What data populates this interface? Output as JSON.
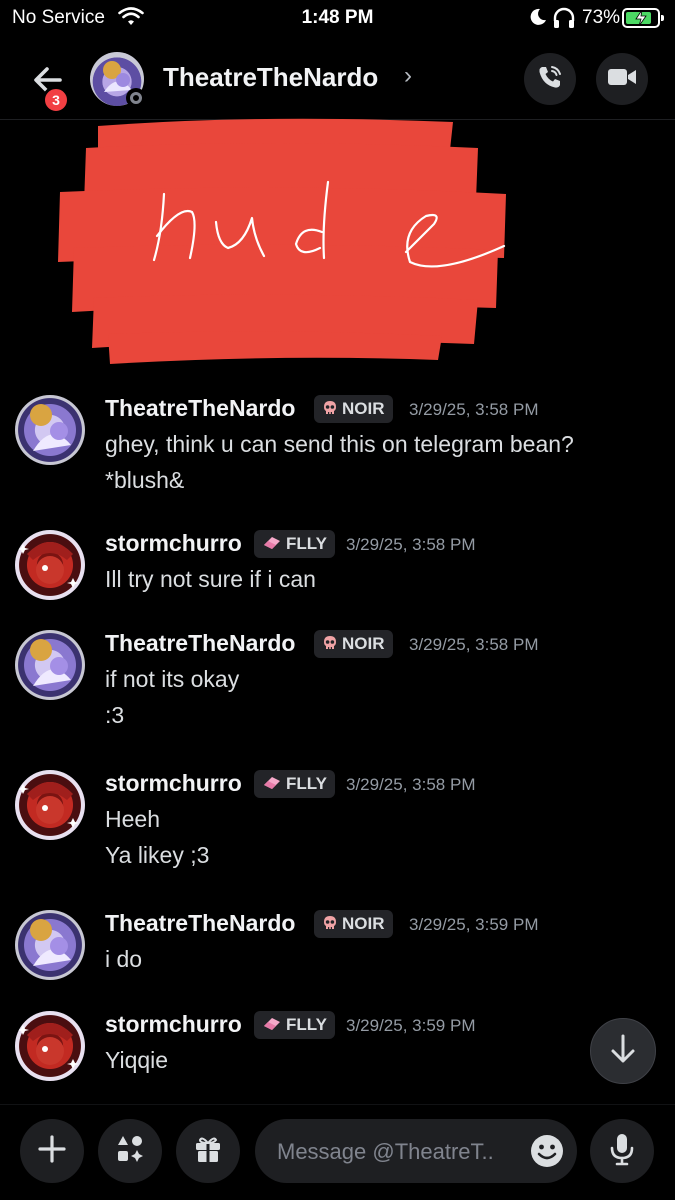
{
  "status_bar": {
    "carrier": "No Service",
    "time": "1:48 PM",
    "battery": "73%",
    "icons": [
      "wifi-icon",
      "moon-icon",
      "headphones-icon",
      "battery-charging-icon"
    ]
  },
  "header": {
    "title": "TheatreTheNardo",
    "chevron": "›",
    "unread_count": "3",
    "icons": [
      "back-arrow-icon",
      "phone-call-icon",
      "video-camera-icon"
    ]
  },
  "attachment": {
    "handwritten_overlay": "nude",
    "redaction_color": "#e9473b"
  },
  "messages": [
    {
      "author": "TheatreTheNardo",
      "tag": "NOIR",
      "tag_icon": "skull-icon",
      "timestamp": "3/29/25, 3:58 PM",
      "lines": [
        "ghey, think u can send this on telegram bean?",
        "*blush&"
      ]
    },
    {
      "author": "stormchurro",
      "tag": "FLLY",
      "tag_icon": "eraser-icon",
      "timestamp": "3/29/25, 3:58 PM",
      "lines": [
        "Ill try not sure if i can"
      ]
    },
    {
      "author": "TheatreTheNardo",
      "tag": "NOIR",
      "tag_icon": "skull-icon",
      "timestamp": "3/29/25, 3:58 PM",
      "lines": [
        "if not its okay",
        ":3"
      ]
    },
    {
      "author": "stormchurro",
      "tag": "FLLY",
      "tag_icon": "eraser-icon",
      "timestamp": "3/29/25, 3:58 PM",
      "lines": [
        "Heeh",
        "Ya likey ;3"
      ]
    },
    {
      "author": "TheatreTheNardo",
      "tag": "NOIR",
      "tag_icon": "skull-icon",
      "timestamp": "3/29/25, 3:59 PM",
      "lines": [
        "i do"
      ]
    },
    {
      "author": "stormchurro",
      "tag": "FLLY",
      "tag_icon": "eraser-icon",
      "timestamp": "3/29/25, 3:59 PM",
      "lines": [
        "Yiqqie"
      ]
    }
  ],
  "composer": {
    "placeholder": "Message @TheatreT..",
    "icons": [
      "plus-icon",
      "apps-icon",
      "gift-icon",
      "emoji-icon",
      "microphone-icon"
    ]
  },
  "colors": {
    "background": "#000000",
    "panel": "#1e1f22",
    "text_primary": "#f2f3f5",
    "text_muted": "#949ba4",
    "badge": "#f23f43",
    "battery_fill": "#4cd964"
  }
}
